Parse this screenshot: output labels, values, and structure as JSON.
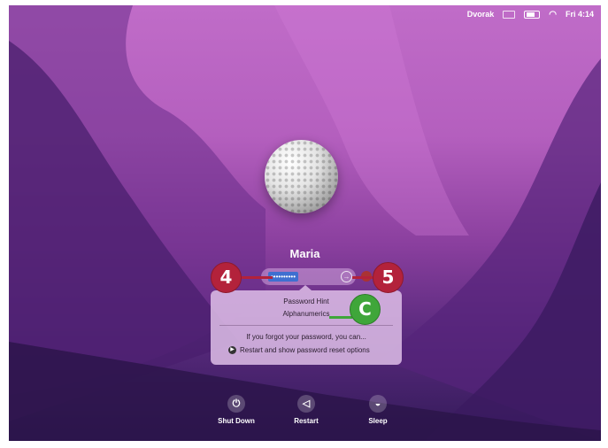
{
  "menubar": {
    "keyboard_layout": "Dvorak",
    "clock": "Fri 4:14",
    "icons": [
      "keyboard-icon",
      "battery-icon",
      "wifi-icon"
    ]
  },
  "user": {
    "name": "Maria",
    "avatar": "golf-ball-avatar"
  },
  "password_field": {
    "masked_value": "••••••••••"
  },
  "hint_panel": {
    "title": "Password Hint",
    "hint": "Alphanumerics",
    "forgot_text": "If you forgot your password, you can...",
    "reset_label": "Restart and show password reset options"
  },
  "callouts": {
    "four": "4",
    "five": "5",
    "c": "C"
  },
  "power_controls": {
    "shutdown": "Shut Down",
    "restart": "Restart",
    "sleep": "Sleep"
  },
  "colors": {
    "callout_red": "#b3223b",
    "callout_green": "#3fa63a",
    "selection_blue": "#3f6fd0"
  }
}
